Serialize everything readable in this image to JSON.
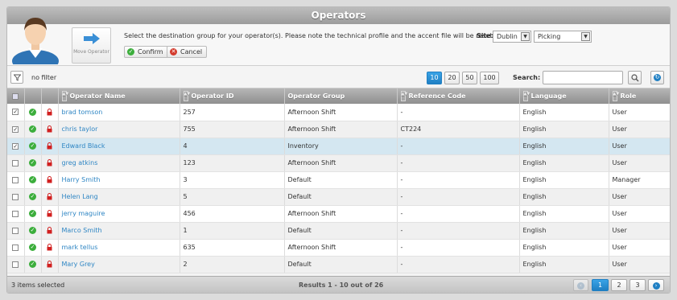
{
  "window": {
    "title": "Operators"
  },
  "header": {
    "move_button_label": "Move Operator",
    "instruction": "Select the destination group for your operator(s). Please note the technical profile and the accent file will be reset.",
    "site_label": "Site:",
    "site_value": "Dublin",
    "group_value": "Picking",
    "confirm_label": "Confirm",
    "cancel_label": "Cancel"
  },
  "toolbar": {
    "filter_text": "no filter",
    "page_sizes": [
      "10",
      "20",
      "50",
      "100"
    ],
    "active_page_size": "10",
    "search_label": "Search:",
    "search_value": ""
  },
  "table": {
    "columns": [
      "Operator Name",
      "Operator ID",
      "Operator Group",
      "Reference Code",
      "Language",
      "Role"
    ],
    "rows": [
      {
        "checked": true,
        "name": "brad tomson",
        "id": "257",
        "group": "Afternoon Shift",
        "ref": "-",
        "language": "English",
        "role": "User"
      },
      {
        "checked": true,
        "name": "chris taylor",
        "id": "755",
        "group": "Afternoon Shift",
        "ref": "CT224",
        "language": "English",
        "role": "User"
      },
      {
        "checked": true,
        "name": "Edward Black",
        "id": "4",
        "group": "Inventory",
        "ref": "-",
        "language": "English",
        "role": "User"
      },
      {
        "checked": false,
        "name": "greg atkins",
        "id": "123",
        "group": "Afternoon Shift",
        "ref": "-",
        "language": "English",
        "role": "User"
      },
      {
        "checked": false,
        "name": "Harry Smith",
        "id": "3",
        "group": "Default",
        "ref": "-",
        "language": "English",
        "role": "Manager"
      },
      {
        "checked": false,
        "name": "Helen Lang",
        "id": "5",
        "group": "Default",
        "ref": "-",
        "language": "English",
        "role": "User"
      },
      {
        "checked": false,
        "name": "jerry maguire",
        "id": "456",
        "group": "Afternoon Shift",
        "ref": "-",
        "language": "English",
        "role": "User"
      },
      {
        "checked": false,
        "name": "Marco Smith",
        "id": "1",
        "group": "Default",
        "ref": "-",
        "language": "English",
        "role": "User"
      },
      {
        "checked": false,
        "name": "mark tellus",
        "id": "635",
        "group": "Afternoon Shift",
        "ref": "-",
        "language": "English",
        "role": "User"
      },
      {
        "checked": false,
        "name": "Mary Grey",
        "id": "2",
        "group": "Default",
        "ref": "-",
        "language": "English",
        "role": "User"
      }
    ]
  },
  "footer": {
    "selected_text": "3 items selected",
    "results_text": "Results 1 - 10 out of 26",
    "pages": [
      "1",
      "2",
      "3"
    ],
    "active_page": "1"
  },
  "colors": {
    "accent": "#1f7fc3",
    "link": "#2f86c4",
    "status_ok": "#3cae3c",
    "lock": "#d11f1f",
    "highlight_row": "#d4e7f1"
  }
}
